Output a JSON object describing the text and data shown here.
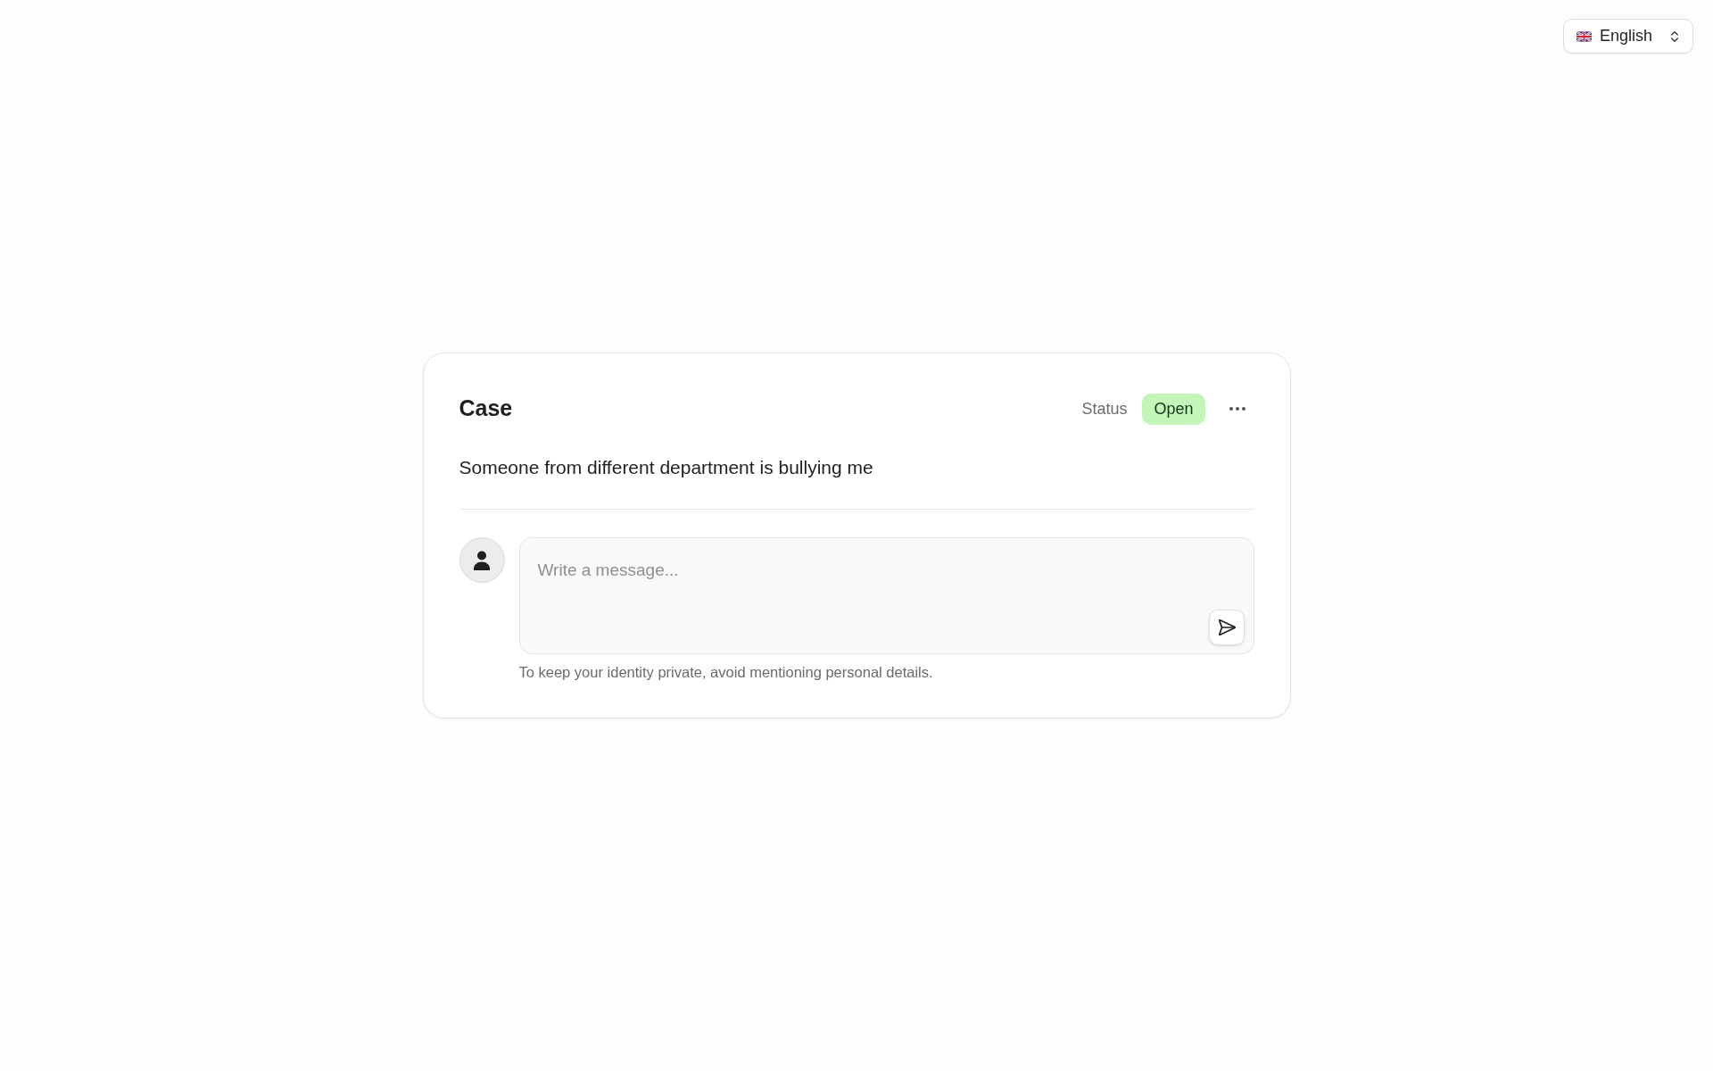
{
  "language_selector": {
    "label": "English"
  },
  "case": {
    "title": "Case",
    "status_label": "Status",
    "status": {
      "label": "Open",
      "kind": "open"
    },
    "description": "Someone from different department is bullying me",
    "composer": {
      "placeholder": "Write a message...",
      "hint": "To keep your identity private, avoid mentioning personal details."
    }
  }
}
